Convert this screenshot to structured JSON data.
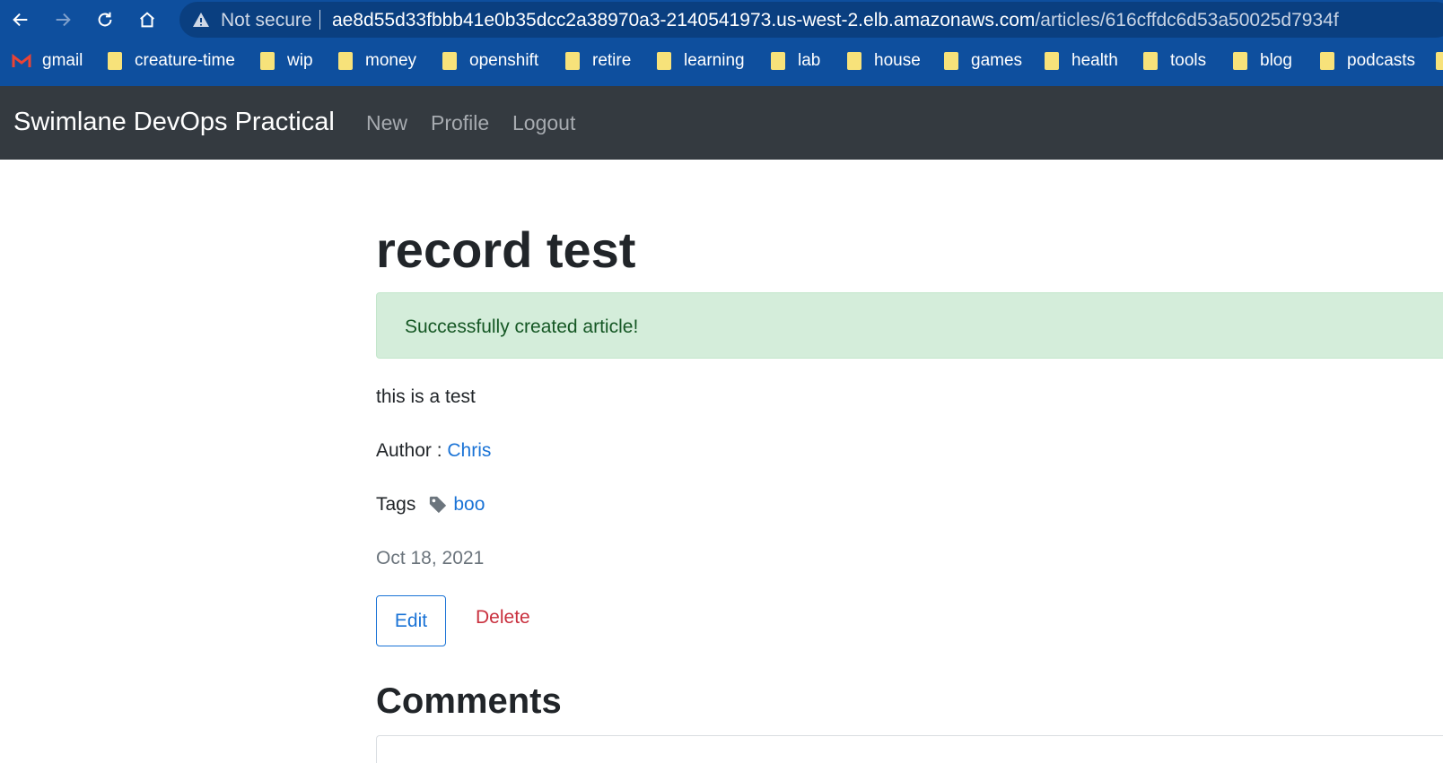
{
  "browser": {
    "security_label": "Not secure",
    "url_host": "ae8d55d33fbbb41e0b35dcc2a38970a3-2140541973.us-west-2.elb.amazonaws.com",
    "url_path": "/articles/616cffdc6d53a50025d7934f",
    "bookmarks": [
      "gmail",
      "creature-time",
      "wip",
      "money",
      "openshift",
      "retire",
      "learning",
      "lab",
      "house",
      "games",
      "health",
      "tools",
      "blog",
      "podcasts"
    ]
  },
  "navbar": {
    "brand": "Swimlane DevOps Practical",
    "links": [
      "New",
      "Profile",
      "Logout"
    ]
  },
  "article": {
    "title": "record test",
    "alert": "Successfully created article!",
    "body": "this is a test",
    "author_label": "Author : ",
    "author_name": "Chris",
    "tags_label": "Tags",
    "tag": "boo",
    "date": "Oct 18, 2021",
    "edit_label": "Edit",
    "delete_label": "Delete",
    "comments_heading": "Comments"
  },
  "colors": {
    "chrome": "#0e4f9e",
    "navbar": "#343a40",
    "link": "#1a73d6",
    "danger": "#c9303e",
    "alert_bg": "#d4edda"
  }
}
